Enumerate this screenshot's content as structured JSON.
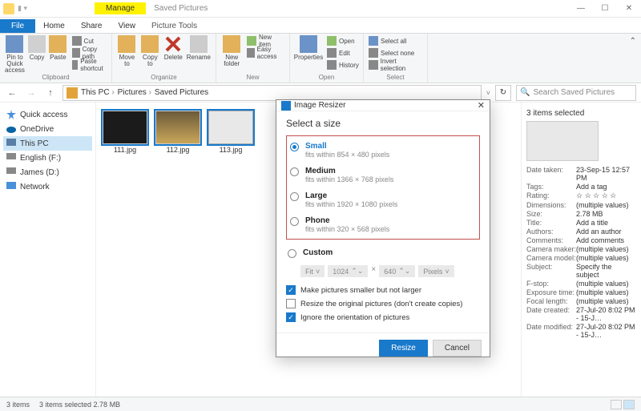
{
  "titlebar": {
    "context_tab": "Manage",
    "window_title": "Saved Pictures",
    "min": "—",
    "max": "☐",
    "close": "✕"
  },
  "ribbon_tabs": {
    "file": "File",
    "home": "Home",
    "share": "Share",
    "view": "View",
    "picture": "Picture Tools"
  },
  "ribbon": {
    "pin": "Pin to Quick access",
    "copy": "Copy",
    "paste": "Paste",
    "cut": "Cut",
    "copy_path": "Copy path",
    "paste_shortcut": "Paste shortcut",
    "clipboard_group": "Clipboard",
    "move": "Move to",
    "copy_to": "Copy to",
    "delete": "Delete",
    "rename": "Rename",
    "organize_group": "Organize",
    "new_folder": "New folder",
    "new_item": "New item",
    "easy_access": "Easy access",
    "new_group": "New",
    "properties": "Properties",
    "open": "Open",
    "edit": "Edit",
    "history": "History",
    "open_group": "Open",
    "select_all": "Select all",
    "select_none": "Select none",
    "invert": "Invert selection",
    "select_group": "Select"
  },
  "address": {
    "crumbs": [
      "This PC",
      "Pictures",
      "Saved Pictures"
    ],
    "refresh": "↻",
    "search_placeholder": "Search Saved Pictures"
  },
  "nav": {
    "quick": "Quick access",
    "onedrive": "OneDrive",
    "thispc": "This PC",
    "english": "English (F:)",
    "james": "James (D:)",
    "network": "Network"
  },
  "files": [
    {
      "name": "111.jpg"
    },
    {
      "name": "112.jpg"
    },
    {
      "name": "113.jpg"
    }
  ],
  "details": {
    "heading": "3 items selected",
    "rows": [
      {
        "k": "Date taken:",
        "v": "23-Sep-15 12:57 PM"
      },
      {
        "k": "Tags:",
        "v": "Add a tag"
      },
      {
        "k": "Rating:",
        "v": "☆ ☆ ☆ ☆ ☆"
      },
      {
        "k": "Dimensions:",
        "v": "(multiple values)"
      },
      {
        "k": "Size:",
        "v": "2.78 MB"
      },
      {
        "k": "Title:",
        "v": "Add a title"
      },
      {
        "k": "Authors:",
        "v": "Add an author"
      },
      {
        "k": "Comments:",
        "v": "Add comments"
      },
      {
        "k": "Camera maker:",
        "v": "(multiple values)"
      },
      {
        "k": "Camera model:",
        "v": "(multiple values)"
      },
      {
        "k": "Subject:",
        "v": "Specify the subject"
      },
      {
        "k": "F-stop:",
        "v": "(multiple values)"
      },
      {
        "k": "Exposure time:",
        "v": "(multiple values)"
      },
      {
        "k": "Focal length:",
        "v": "(multiple values)"
      },
      {
        "k": "Date created:",
        "v": "27-Jul-20 8:02 PM - 15-J…"
      },
      {
        "k": "Date modified:",
        "v": "27-Jul-20 8:02 PM - 15-J…"
      }
    ]
  },
  "status": {
    "count": "3 items",
    "selected": "3 items selected  2.78 MB"
  },
  "dialog": {
    "title": "Image Resizer",
    "close": "✕",
    "select": "Select a size",
    "options": [
      {
        "label": "Small",
        "sub": "fits within 854 × 480 pixels",
        "selected": true
      },
      {
        "label": "Medium",
        "sub": "fits within 1366 × 768 pixels",
        "selected": false
      },
      {
        "label": "Large",
        "sub": "fits within 1920 × 1080 pixels",
        "selected": false
      },
      {
        "label": "Phone",
        "sub": "fits within 320 × 568 pixels",
        "selected": false
      }
    ],
    "custom_label": "Custom",
    "custom": {
      "mode": "Fit",
      "w": "1024",
      "x": "×",
      "h": "640",
      "unit": "Pixels"
    },
    "checks": [
      {
        "label": "Make pictures smaller but not larger",
        "on": true
      },
      {
        "label": "Resize the original pictures (don't create copies)",
        "on": false
      },
      {
        "label": "Ignore the orientation of pictures",
        "on": true
      }
    ],
    "resize_btn": "Resize",
    "cancel_btn": "Cancel"
  }
}
